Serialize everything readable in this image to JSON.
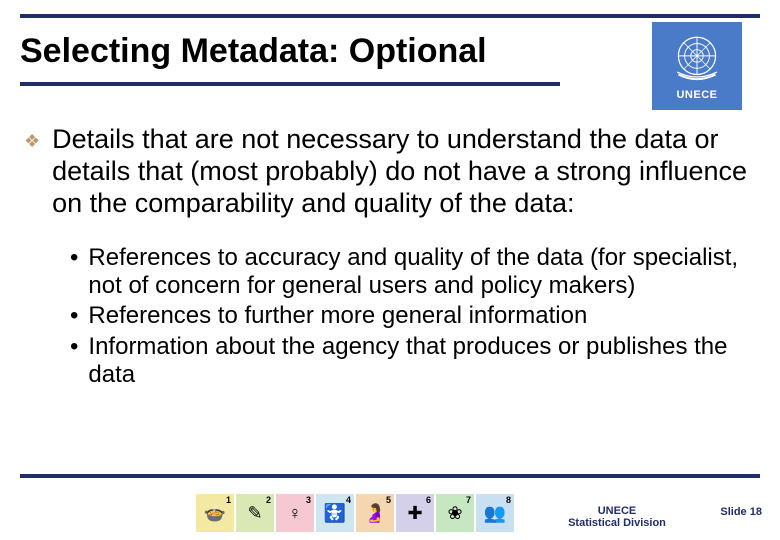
{
  "title": "Selecting Metadata: Optional",
  "logo": {
    "label": "UNECE"
  },
  "main_bullet": "Details that are not necessary to understand the data or details that (most probably) do not have a strong influence on the  comparability and quality of the data:",
  "sub_bullets": [
    "References to accuracy and quality of the data (for specialist, not of concern for general users and policy makers)",
    "References to further more general information",
    "Information about the agency that produces or publishes the data"
  ],
  "mdg_icons": [
    {
      "num": "1",
      "bg": "#f3e9a3",
      "glyph": "🍲"
    },
    {
      "num": "2",
      "bg": "#d9e8b5",
      "glyph": "✎"
    },
    {
      "num": "3",
      "bg": "#f6c9d2",
      "glyph": "♀"
    },
    {
      "num": "4",
      "bg": "#cfe6ef",
      "glyph": "🚼"
    },
    {
      "num": "5",
      "bg": "#f4d7b1",
      "glyph": "🤰"
    },
    {
      "num": "6",
      "bg": "#d4d0ea",
      "glyph": "✚"
    },
    {
      "num": "7",
      "bg": "#c7e6c2",
      "glyph": "❀"
    },
    {
      "num": "8",
      "bg": "#c9dff2",
      "glyph": "👥"
    }
  ],
  "footer": {
    "org_line1": "UNECE",
    "org_line2": "Statistical Division",
    "slide_label": "Slide",
    "slide_number": "18"
  }
}
